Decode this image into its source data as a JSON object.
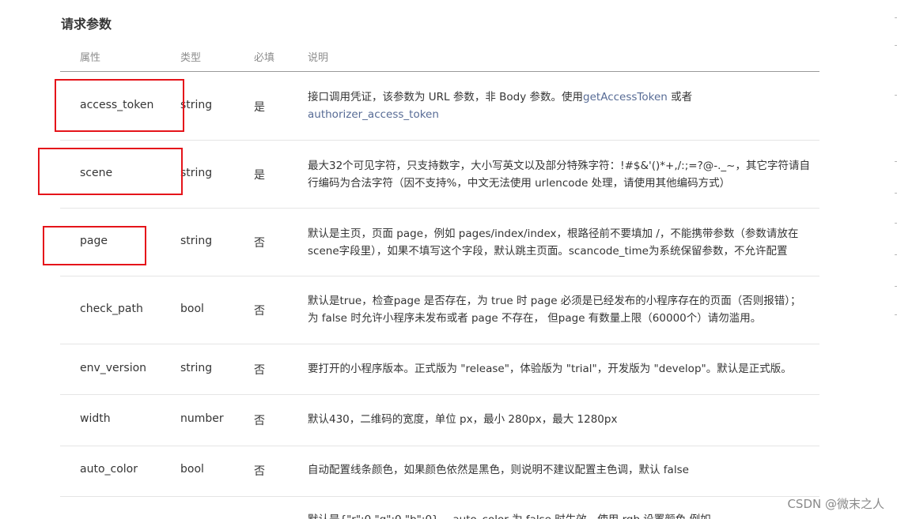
{
  "section_title": "请求参数",
  "columns": {
    "name": "属性",
    "type": "类型",
    "required": "必填",
    "desc": "说明"
  },
  "rows": [
    {
      "name": "access_token",
      "type": "string",
      "required": "是",
      "desc_pre": "接口调用凭证，该参数为 URL 参数，非 Body 参数。使用",
      "desc_link1": "getAccessToken",
      "desc_mid": " 或者",
      "desc_link2": "authorizer_access_token"
    },
    {
      "name": "scene",
      "type": "string",
      "required": "是",
      "desc_line1": "最大32个可见字符，只支持数字，大小写英文以及部分特殊字符：!#$&'()*+,/:;=?@-._~，其它字符请自",
      "desc_line2": "行编码为合法字符（因不支持%，中文无法使用 urlencode 处理，请使用其他编码方式）"
    },
    {
      "name": "page",
      "type": "string",
      "required": "否",
      "desc_line1": "默认是主页，页面 page，例如 pages/index/index，根路径前不要填加 /，不能携带参数（参数请放在",
      "desc_line2": "scene字段里），如果不填写这个字段，默认跳主页面。scancode_time为系统保留参数，不允许配置"
    },
    {
      "name": "check_path",
      "type": "bool",
      "required": "否",
      "desc_line1": "默认是true，检查page 是否存在，为 true 时 page 必须是已经发布的小程序存在的页面（否则报错）；",
      "desc_line2": "为 false 时允许小程序未发布或者 page 不存在， 但page 有数量上限（60000个）请勿滥用。"
    },
    {
      "name": "env_version",
      "type": "string",
      "required": "否",
      "desc": "要打开的小程序版本。正式版为 \"release\"，体验版为 \"trial\"，开发版为 \"develop\"。默认是正式版。"
    },
    {
      "name": "width",
      "type": "number",
      "required": "否",
      "desc": "默认430，二维码的宽度，单位 px，最小 280px，最大 1280px"
    },
    {
      "name": "auto_color",
      "type": "bool",
      "required": "否",
      "desc": "自动配置线条颜色，如果颜色依然是黑色，则说明不建议配置主色调，默认 false"
    },
    {
      "desc_partial": "默认是{\"r\":0,\"g\":0,\"b\":0} ，auto_color 为 false 时生效，使用 rgb 设置颜色 例如"
    }
  ],
  "watermark": "CSDN @微末之人",
  "colors": {
    "highlight": "#e5141a",
    "link": "#576b95",
    "header_text": "#8d8d8d"
  }
}
